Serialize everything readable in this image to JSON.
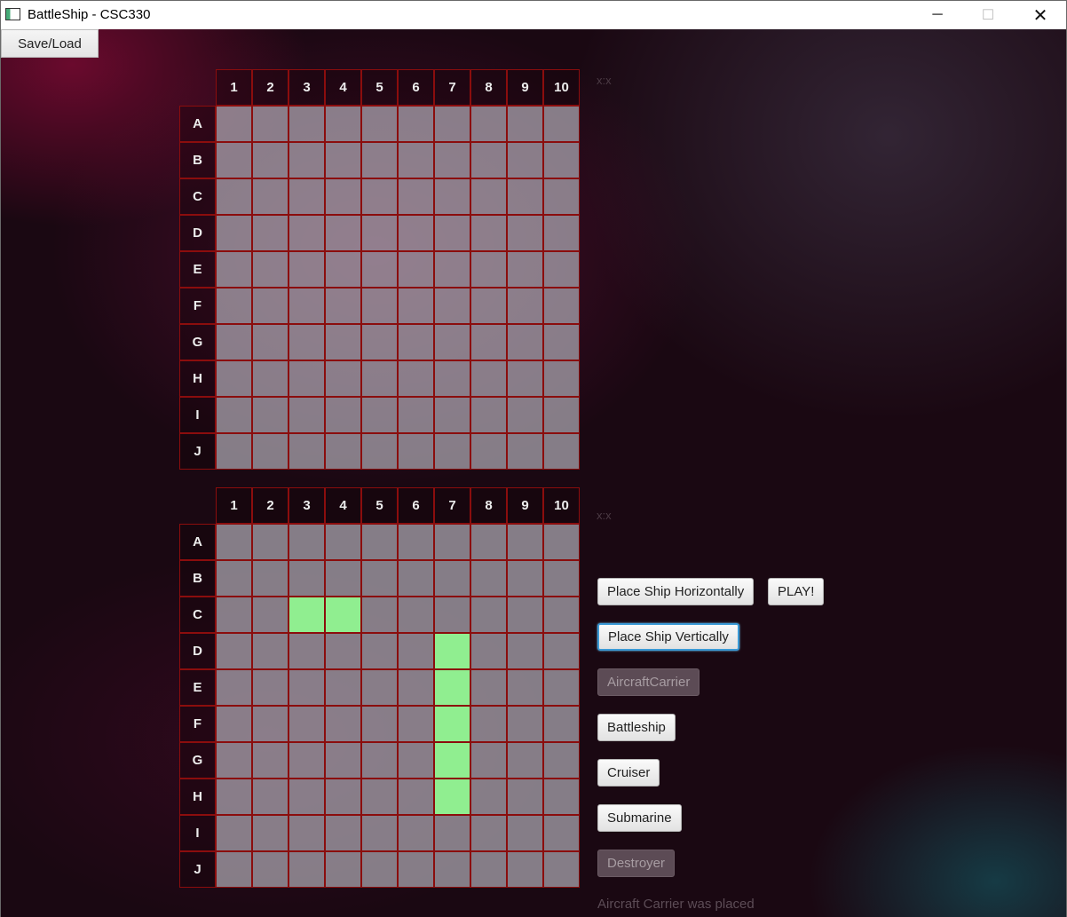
{
  "window": {
    "title": "BattleShip - CSC330",
    "minimize_glyph": "─",
    "maximize_glyph": "☐",
    "close_glyph": "✕"
  },
  "menu": {
    "save_load_label": "Save/Load"
  },
  "grid": {
    "columns": [
      "1",
      "2",
      "3",
      "4",
      "5",
      "6",
      "7",
      "8",
      "9",
      "10"
    ],
    "rows": [
      "A",
      "B",
      "C",
      "D",
      "E",
      "F",
      "G",
      "H",
      "I",
      "J"
    ]
  },
  "top_board": {
    "coord_label": "x:x",
    "ship_cells": []
  },
  "bottom_board": {
    "coord_label": "x:x",
    "ship_cells": [
      "C3",
      "C4",
      "D7",
      "E7",
      "F7",
      "G7",
      "H7"
    ],
    "ship_color": "#90ee90"
  },
  "controls": {
    "place_horizontal": "Place Ship Horizontally",
    "play": "PLAY!",
    "place_vertical": "Place Ship Vertically",
    "ships": [
      {
        "label": "AircraftCarrier",
        "enabled": false
      },
      {
        "label": "Battleship",
        "enabled": true
      },
      {
        "label": "Cruiser",
        "enabled": true
      },
      {
        "label": "Submarine",
        "enabled": true
      },
      {
        "label": "Destroyer",
        "enabled": false
      }
    ]
  },
  "status_message": "Aircraft Carrier was placed",
  "colors": {
    "grid_border": "#8b0d0d",
    "focus_ring": "#3b9ad6"
  }
}
